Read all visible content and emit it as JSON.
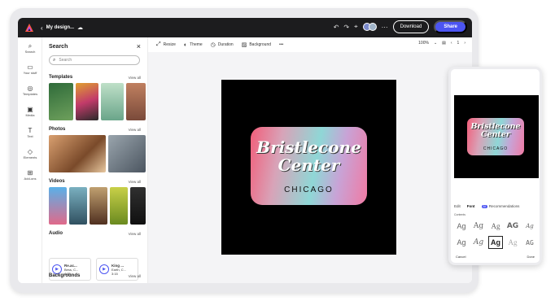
{
  "topbar": {
    "doc_name": "My design...",
    "download_label": "Download",
    "share_label": "Share"
  },
  "rail": {
    "items": [
      {
        "label": "Search",
        "icon": "search-icon"
      },
      {
        "label": "Your stuff",
        "icon": "folder-icon"
      },
      {
        "label": "Templates",
        "icon": "templates-icon"
      },
      {
        "label": "Media",
        "icon": "media-icon"
      },
      {
        "label": "Text",
        "icon": "text-icon"
      },
      {
        "label": "Elements",
        "icon": "elements-icon"
      },
      {
        "label": "Add-ons",
        "icon": "addons-icon"
      }
    ]
  },
  "panel": {
    "title": "Search",
    "search_placeholder": "Search",
    "templates_label": "Templates",
    "photos_label": "Photos",
    "videos_label": "Videos",
    "audio_label": "Audio",
    "backgrounds_label": "Backgrounds",
    "view_all": "View all",
    "audio": [
      {
        "title": "Re.ac...",
        "sub": "Bess, C...",
        "time": "4:25"
      },
      {
        "title": "King ...",
        "sub": "Earth, C...",
        "time": "3:15"
      }
    ]
  },
  "toolbar": {
    "resize": "Resize",
    "theme": "Theme",
    "duration": "Duration",
    "background": "Background",
    "more": "•••",
    "zoom": "100%",
    "page": "1"
  },
  "artboard": {
    "line1": "Bristlecone",
    "line2": "Center",
    "line3": "CHICAGO"
  },
  "phone": {
    "tabs": {
      "edit": "Edit",
      "font": "Font",
      "badge": "AI",
      "recommendations": "Recommendations"
    },
    "contents": "Contents",
    "cancel": "Cancel",
    "done": "Done"
  },
  "colors": {
    "accent": "#4c55f2",
    "topbar": "#1c1c1e"
  }
}
